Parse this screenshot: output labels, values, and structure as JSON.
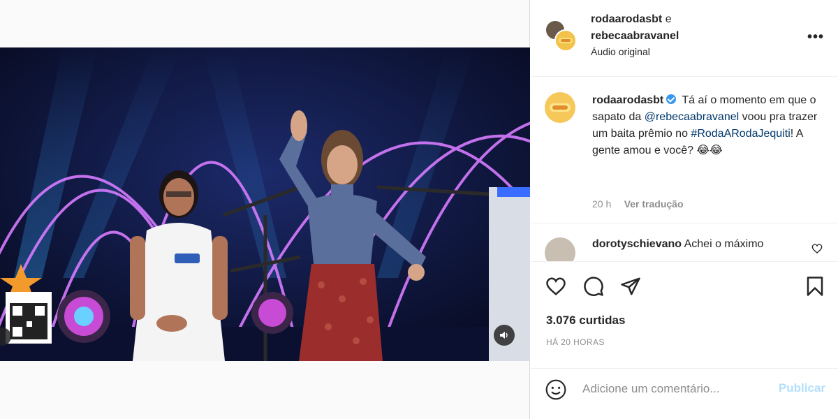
{
  "header": {
    "user1": "rodaarodasbt",
    "conj": "e",
    "user2": "rebecaabravanel",
    "audio": "Áudio original",
    "more_label": "•••"
  },
  "caption": {
    "username": "rodaarodasbt",
    "text_1": "Tá aí o momento em que o sapato da",
    "mention": "@rebecaabravanel",
    "text_2": "voou pra trazer um baita prêmio no",
    "hashtag": "#RodaARodaJequiti",
    "text_3": "! A gente amou e você? 😂😂",
    "time": "20 h",
    "translate": "Ver tradução"
  },
  "comment": {
    "username": "dorotyschievano",
    "text": "Achei o máximo"
  },
  "actions": {
    "likes": "3.076 curtidas",
    "ago": "HÁ 20 HORAS"
  },
  "add_comment": {
    "placeholder": "Adicione um comentário...",
    "publish": "Publicar"
  },
  "colors": {
    "link": "#00376b",
    "verified": "#3897f0",
    "publish_disabled": "#b2dffc"
  }
}
